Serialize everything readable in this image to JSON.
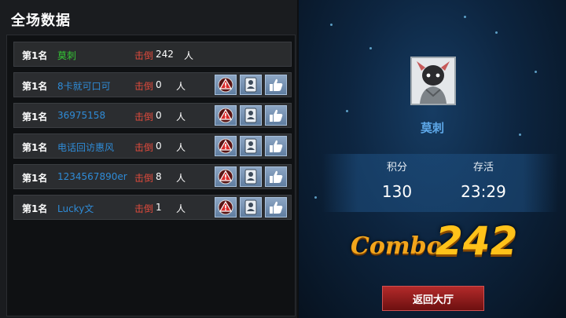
{
  "title": "全场数据",
  "rows": [
    {
      "rank": "第1名",
      "name": "莫刺",
      "kill_label": "击倒",
      "kills": "242",
      "unit": "人",
      "me": true
    },
    {
      "rank": "第1名",
      "name": "8卡就可口可",
      "kill_label": "击倒",
      "kills": "0",
      "unit": "人"
    },
    {
      "rank": "第1名",
      "name": "36975158",
      "kill_label": "击倒",
      "kills": "0",
      "unit": "人"
    },
    {
      "rank": "第1名",
      "name": "电话回访惠风",
      "kill_label": "击倒",
      "kills": "0",
      "unit": "人"
    },
    {
      "rank": "第1名",
      "name": "1234567890er",
      "kill_label": "击倒",
      "kills": "8",
      "unit": "人"
    },
    {
      "rank": "第1名",
      "name": "Lucky文",
      "kill_label": "击倒",
      "kills": "1",
      "unit": "人"
    }
  ],
  "player": {
    "name": "莫刺",
    "score_label": "积分",
    "score": "130",
    "survive_label": "存活",
    "survive": "23:29"
  },
  "combo": {
    "word": "Combo",
    "count": "242"
  },
  "back_button": "返回大厅",
  "colors": {
    "my_name": "#35c635",
    "other_name": "#2f8bd6",
    "kill_label": "#e14a3c",
    "combo": "#ffc21a"
  },
  "icons": {
    "report": "warning-icon",
    "card": "profile-card-icon",
    "like": "thumbs-up-icon"
  }
}
